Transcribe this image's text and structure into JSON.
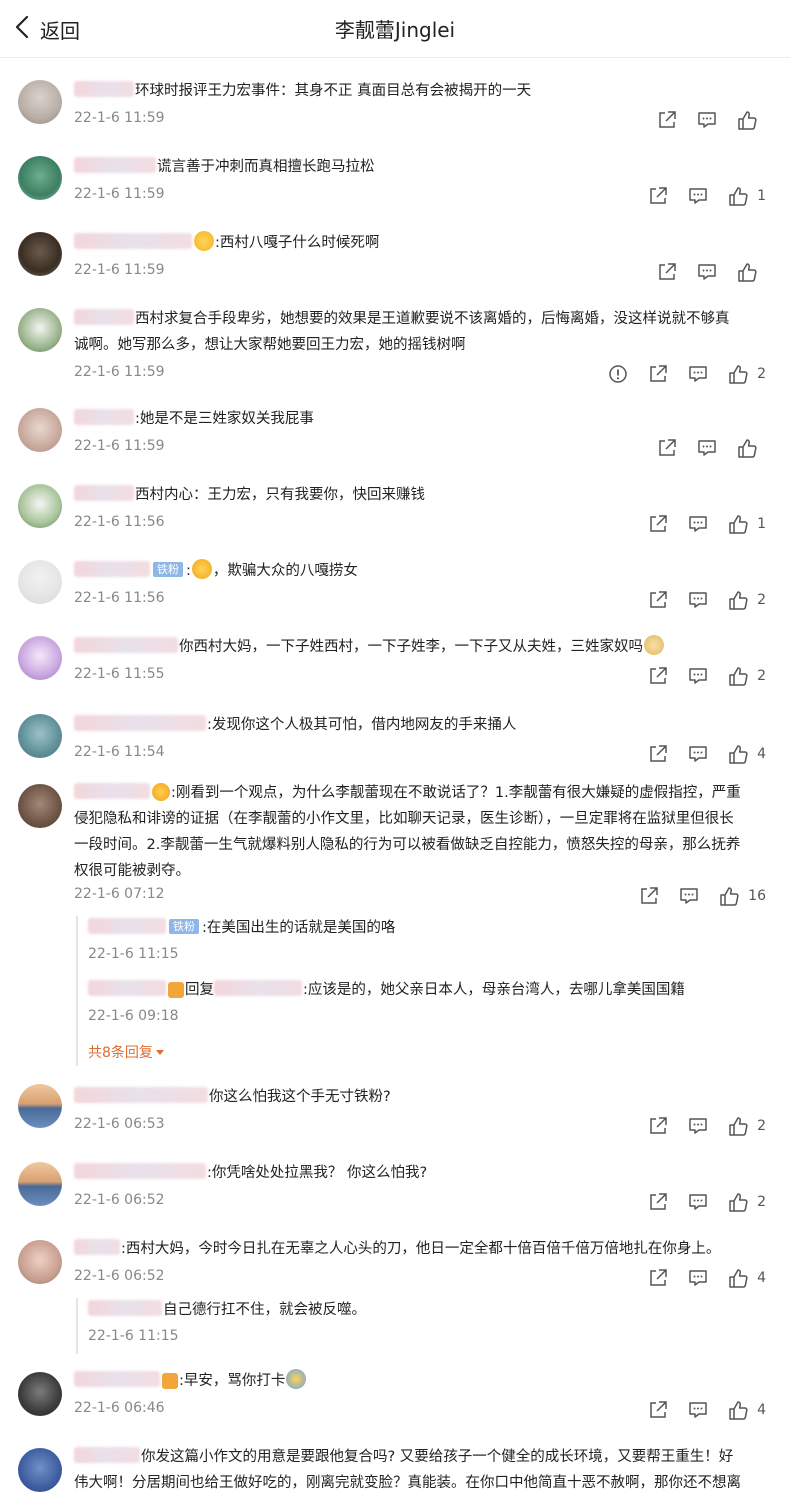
{
  "header": {
    "back_label": "返回",
    "title": "李靓蕾Jinglei"
  },
  "comments": [
    {
      "text": "环球时报评王力宏事件：其身不正 真面目总有会被揭开的一天",
      "time": "22-1-6 11:59",
      "likes": "",
      "report": false
    },
    {
      "text": "谎言善于冲刺而真相擅长跑马拉松",
      "time": "22-1-6 11:59",
      "likes": "1",
      "report": false
    },
    {
      "text": ":西村八嘎子什么时候死啊",
      "time": "22-1-6 11:59",
      "likes": "",
      "report": false
    },
    {
      "text_line1": "西村求复合手段卑劣，她想要的效果是王道歉要说不该离婚的，后悔离婚，没这样说就不够真",
      "text_line2": "诚啊。她写那么多，想让大家帮她要回王力宏，她的摇钱树啊",
      "time": "22-1-6 11:59",
      "likes": "2",
      "report": true
    },
    {
      "text": ":她是不是三姓家奴关我屁事",
      "time": "22-1-6 11:59",
      "likes": "",
      "report": false
    },
    {
      "text": "西村内心：王力宏，只有我要你，快回来赚钱",
      "time": "22-1-6 11:56",
      "likes": "1",
      "report": false
    },
    {
      "badge": "铁粉",
      "text": "，欺骗大众的八嘎捞女",
      "time": "22-1-6 11:56",
      "likes": "2",
      "report": false
    },
    {
      "text": "你西村大妈，一下子姓西村，一下子姓李，一下子又从夫姓，三姓家奴吗",
      "time": "22-1-6 11:55",
      "likes": "2",
      "report": false
    },
    {
      "text": ":发现你这个人极其可怕，借内地网友的手来捅人",
      "time": "22-1-6 11:54",
      "likes": "4",
      "report": false
    },
    {
      "text_line1": ":刚看到一个观点，为什么李靓蕾现在不敢说话了？1.李靓蕾有很大嫌疑的虚假指控，严重",
      "text_line2": "侵犯隐私和诽谤的证据（在李靓蕾的小作文里，比如聊天记录，医生诊断），一旦定罪将在监狱里但很长",
      "text_line3": "一段时间。2.李靓蕾一生气就爆料别人隐私的行为可以被看做缺乏自控能力，愤怒失控的母亲，那么抚养",
      "text_line4": "权很可能被剥夺。",
      "time": "22-1-6 07:12",
      "likes": "16",
      "report": false,
      "replies": [
        {
          "badge": "铁粉",
          "text": ":在美国出生的话就是美国的咯",
          "time": "22-1-6 11:15"
        },
        {
          "reply_word": "回复",
          "text": ":应该是的，她父亲日本人，母亲台湾人，去哪儿拿美国国籍",
          "time": "22-1-6 09:18"
        }
      ],
      "more_replies": "共8条回复"
    },
    {
      "text": "你这么怕我这个手无寸铁粉?",
      "time": "22-1-6 06:53",
      "likes": "2",
      "report": false
    },
    {
      "text": ":你凭啥处处拉黑我？ 你这么怕我?",
      "time": "22-1-6 06:52",
      "likes": "2",
      "report": false
    },
    {
      "text": ":西村大妈，今时今日扎在无辜之人心头的刀，他日一定全都十倍百倍千倍万倍地扎在你身上。",
      "time": "22-1-6 06:52",
      "likes": "4",
      "report": false,
      "replies": [
        {
          "text": "自己德行扛不住，就会被反噬。",
          "time": "22-1-6 11:15"
        }
      ]
    },
    {
      "text": ":早安，骂你打卡",
      "time": "22-1-6 06:46",
      "likes": "4",
      "report": false
    },
    {
      "text_line1": "你发这篇小作文的用意是要跟他复合吗? 又要给孩子一个健全的成长环境，又要帮王重生！好",
      "text_line2": "伟大啊！分居期间也给王做好吃的，刚离完就变脸？真能装。在你口中他简直十恶不赦啊，那你还不想离"
    }
  ],
  "colors": {
    "accent": "#e06d2f",
    "badge": "#8fb6e8",
    "muted": "#888888"
  },
  "icons": [
    "back-icon",
    "share-icon",
    "comment-icon",
    "like-icon",
    "report-icon"
  ]
}
